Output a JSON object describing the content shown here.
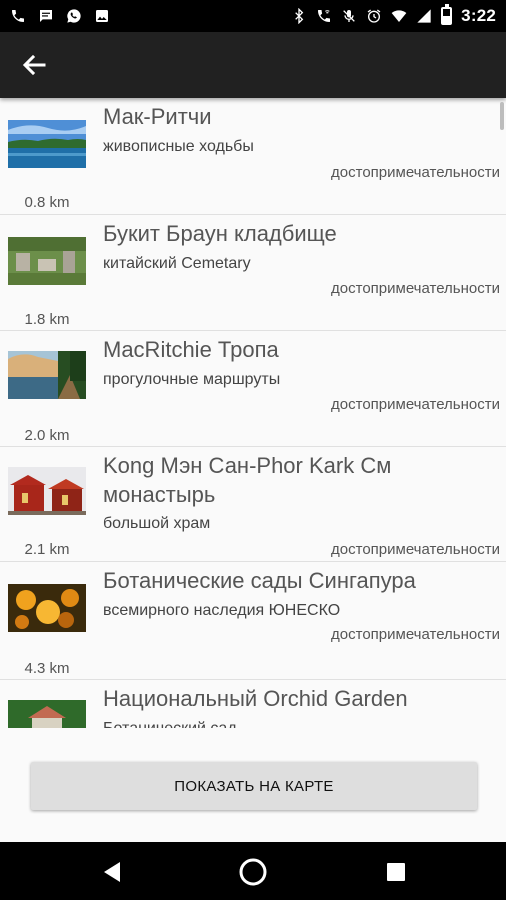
{
  "status_bar": {
    "time": "3:22",
    "left_icons": [
      "phone-icon",
      "message-icon",
      "whatsapp-icon",
      "image-icon"
    ],
    "right_icons": [
      "bluetooth-icon",
      "wifi-calling-icon",
      "mute-icon",
      "alarm-icon",
      "wifi-icon",
      "signal-icon",
      "battery-icon"
    ],
    "battery_level": 0.5
  },
  "app_bar": {
    "back_icon": "arrow-left-icon"
  },
  "places": [
    {
      "title": "Мак-Ритчи",
      "subtitle": "живописные ходьбы",
      "category": "достопримечательности",
      "distance": "0.8 km"
    },
    {
      "title": "Букит Браун кладбище",
      "subtitle": "китайский Cemetary",
      "category": "достопримечательности",
      "distance": "1.8 km"
    },
    {
      "title": "MacRitchie Тропа",
      "subtitle": "прогулочные маршруты",
      "category": "достопримечательности",
      "distance": "2.0 km"
    },
    {
      "title": "Kong Мэн Сан-Phor Kark См монастырь",
      "subtitle": "большой храм",
      "category": "достопримечательности",
      "distance": "2.1 km"
    },
    {
      "title": "Ботанические сады Сингапура",
      "subtitle": "всемирного наследия ЮНЕСКО",
      "category": "достопримечательности",
      "distance": "4.3 km"
    },
    {
      "title": "Национальный Orchid Garden",
      "subtitle": "Ботанический сад",
      "category": "",
      "distance": ""
    }
  ],
  "map_button": {
    "label": "ПОКАЗАТЬ НА КАРТЕ"
  },
  "nav_bar": {
    "icons": [
      "back-triangle-icon",
      "home-circle-icon",
      "recents-square-icon"
    ]
  }
}
